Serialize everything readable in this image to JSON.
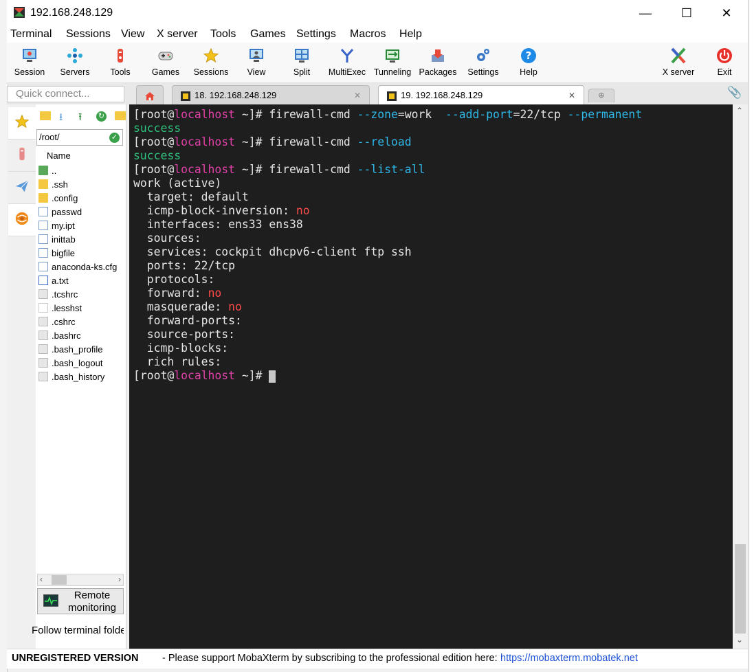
{
  "window": {
    "title": "192.168.248.129"
  },
  "menu": [
    "Terminal",
    "Sessions",
    "View",
    "X server",
    "Tools",
    "Games",
    "Settings",
    "Macros",
    "Help"
  ],
  "toolbar": [
    {
      "label": "Session",
      "icon": "session-icon"
    },
    {
      "label": "Servers",
      "icon": "servers-icon"
    },
    {
      "label": "Tools",
      "icon": "tools-icon"
    },
    {
      "label": "Games",
      "icon": "games-icon"
    },
    {
      "label": "Sessions",
      "icon": "star-icon"
    },
    {
      "label": "View",
      "icon": "view-icon"
    },
    {
      "label": "Split",
      "icon": "split-icon"
    },
    {
      "label": "MultiExec",
      "icon": "multiexec-icon"
    },
    {
      "label": "Tunneling",
      "icon": "tunneling-icon"
    },
    {
      "label": "Packages",
      "icon": "packages-icon"
    },
    {
      "label": "Settings",
      "icon": "gears-icon"
    },
    {
      "label": "Help",
      "icon": "help-icon"
    },
    {
      "label": "X server",
      "icon": "x-server-icon"
    },
    {
      "label": "Exit",
      "icon": "power-icon"
    }
  ],
  "quick_connect": {
    "placeholder": "Quick connect..."
  },
  "tabs": [
    {
      "label": "18. 192.168.248.129",
      "active": false
    },
    {
      "label": "19. 192.168.248.129",
      "active": true
    }
  ],
  "sftp": {
    "path": "/root/",
    "column": "Name",
    "files": [
      {
        "name": "..",
        "kind": "up"
      },
      {
        "name": ".ssh",
        "kind": "folder"
      },
      {
        "name": ".config",
        "kind": "folder"
      },
      {
        "name": "passwd",
        "kind": "file"
      },
      {
        "name": "my.ipt",
        "kind": "file"
      },
      {
        "name": "inittab",
        "kind": "file"
      },
      {
        "name": "bigfile",
        "kind": "file"
      },
      {
        "name": "anaconda-ks.cfg",
        "kind": "file"
      },
      {
        "name": "a.txt",
        "kind": "file"
      },
      {
        "name": ".tcshrc",
        "kind": "dotfile"
      },
      {
        "name": ".lesshst",
        "kind": "dotfile"
      },
      {
        "name": ".cshrc",
        "kind": "dotfile"
      },
      {
        "name": ".bashrc",
        "kind": "dotfile"
      },
      {
        "name": ".bash_profile",
        "kind": "dotfile"
      },
      {
        "name": ".bash_logout",
        "kind": "dotfile"
      },
      {
        "name": ".bash_history",
        "kind": "dotfile"
      }
    ],
    "remote_monitoring": "Remote monitoring",
    "follow_label": "Follow terminal folder"
  },
  "terminal": {
    "prompt": {
      "open": "[root@",
      "host": "localhost",
      "close": " ~]# "
    },
    "cmd1": {
      "base": "firewall-cmd ",
      "opt1": "--zone",
      "val1": "=work  ",
      "opt2": "--add-port",
      "val2": "=22/tcp ",
      "opt3": "--permanent"
    },
    "result1": "success",
    "cmd2": {
      "base": "firewall-cmd ",
      "opt": "--reload"
    },
    "result2": "success",
    "cmd3": {
      "base": "firewall-cmd ",
      "opt": "--list-all"
    },
    "output": {
      "zone": "work (active)",
      "target": "  target: default",
      "icmp_inv_label": "  icmp-block-inversion: ",
      "icmp_inv_value": "no",
      "interfaces": "  interfaces: ens33 ens38",
      "sources": "  sources:",
      "services": "  services: cockpit dhcpv6-client ftp ssh",
      "ports": "  ports: 22/tcp",
      "protocols": "  protocols:",
      "forward_label": "  forward: ",
      "forward_value": "no",
      "masq_label": "  masquerade: ",
      "masq_value": "no",
      "forward_ports": "  forward-ports:",
      "source_ports": "  source-ports:",
      "icmp_blocks": "  icmp-blocks:",
      "rich_rules": "  rich rules:"
    }
  },
  "status": {
    "unregistered": "UNREGISTERED VERSION",
    "message": "-  Please support MobaXterm by subscribing to the professional edition here:",
    "link": "https://mobaxterm.mobatek.net"
  },
  "colors": {
    "terminal_bg": "#1e1e1e",
    "host": "#e040a8",
    "option": "#2fb8e8",
    "success": "#2ec27e",
    "no": "#ff4a4a",
    "link": "#1a4fd6"
  }
}
